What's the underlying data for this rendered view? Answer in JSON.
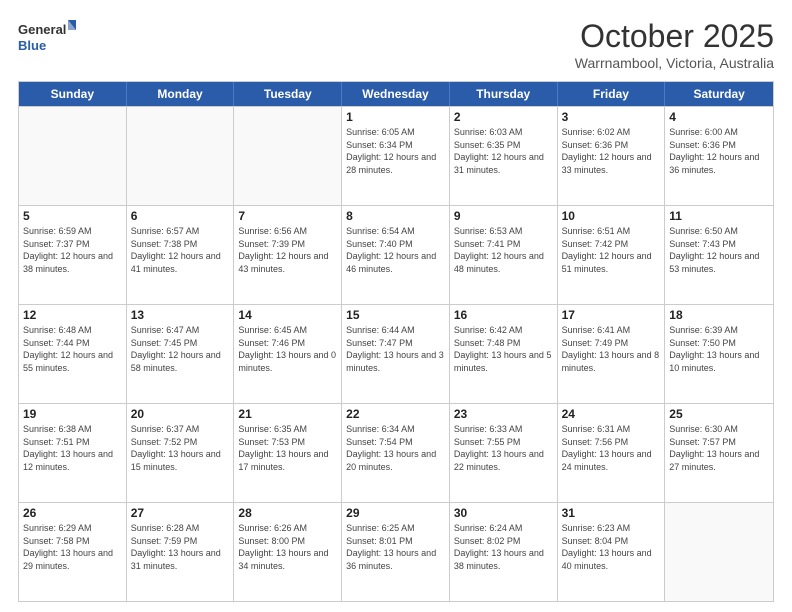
{
  "header": {
    "logo_general": "General",
    "logo_blue": "Blue",
    "month_title": "October 2025",
    "subtitle": "Warrnambool, Victoria, Australia"
  },
  "weekdays": [
    "Sunday",
    "Monday",
    "Tuesday",
    "Wednesday",
    "Thursday",
    "Friday",
    "Saturday"
  ],
  "weeks": [
    [
      {
        "day": "",
        "info": ""
      },
      {
        "day": "",
        "info": ""
      },
      {
        "day": "",
        "info": ""
      },
      {
        "day": "1",
        "info": "Sunrise: 6:05 AM\nSunset: 6:34 PM\nDaylight: 12 hours\nand 28 minutes."
      },
      {
        "day": "2",
        "info": "Sunrise: 6:03 AM\nSunset: 6:35 PM\nDaylight: 12 hours\nand 31 minutes."
      },
      {
        "day": "3",
        "info": "Sunrise: 6:02 AM\nSunset: 6:36 PM\nDaylight: 12 hours\nand 33 minutes."
      },
      {
        "day": "4",
        "info": "Sunrise: 6:00 AM\nSunset: 6:36 PM\nDaylight: 12 hours\nand 36 minutes."
      }
    ],
    [
      {
        "day": "5",
        "info": "Sunrise: 6:59 AM\nSunset: 7:37 PM\nDaylight: 12 hours\nand 38 minutes."
      },
      {
        "day": "6",
        "info": "Sunrise: 6:57 AM\nSunset: 7:38 PM\nDaylight: 12 hours\nand 41 minutes."
      },
      {
        "day": "7",
        "info": "Sunrise: 6:56 AM\nSunset: 7:39 PM\nDaylight: 12 hours\nand 43 minutes."
      },
      {
        "day": "8",
        "info": "Sunrise: 6:54 AM\nSunset: 7:40 PM\nDaylight: 12 hours\nand 46 minutes."
      },
      {
        "day": "9",
        "info": "Sunrise: 6:53 AM\nSunset: 7:41 PM\nDaylight: 12 hours\nand 48 minutes."
      },
      {
        "day": "10",
        "info": "Sunrise: 6:51 AM\nSunset: 7:42 PM\nDaylight: 12 hours\nand 51 minutes."
      },
      {
        "day": "11",
        "info": "Sunrise: 6:50 AM\nSunset: 7:43 PM\nDaylight: 12 hours\nand 53 minutes."
      }
    ],
    [
      {
        "day": "12",
        "info": "Sunrise: 6:48 AM\nSunset: 7:44 PM\nDaylight: 12 hours\nand 55 minutes."
      },
      {
        "day": "13",
        "info": "Sunrise: 6:47 AM\nSunset: 7:45 PM\nDaylight: 12 hours\nand 58 minutes."
      },
      {
        "day": "14",
        "info": "Sunrise: 6:45 AM\nSunset: 7:46 PM\nDaylight: 13 hours\nand 0 minutes."
      },
      {
        "day": "15",
        "info": "Sunrise: 6:44 AM\nSunset: 7:47 PM\nDaylight: 13 hours\nand 3 minutes."
      },
      {
        "day": "16",
        "info": "Sunrise: 6:42 AM\nSunset: 7:48 PM\nDaylight: 13 hours\nand 5 minutes."
      },
      {
        "day": "17",
        "info": "Sunrise: 6:41 AM\nSunset: 7:49 PM\nDaylight: 13 hours\nand 8 minutes."
      },
      {
        "day": "18",
        "info": "Sunrise: 6:39 AM\nSunset: 7:50 PM\nDaylight: 13 hours\nand 10 minutes."
      }
    ],
    [
      {
        "day": "19",
        "info": "Sunrise: 6:38 AM\nSunset: 7:51 PM\nDaylight: 13 hours\nand 12 minutes."
      },
      {
        "day": "20",
        "info": "Sunrise: 6:37 AM\nSunset: 7:52 PM\nDaylight: 13 hours\nand 15 minutes."
      },
      {
        "day": "21",
        "info": "Sunrise: 6:35 AM\nSunset: 7:53 PM\nDaylight: 13 hours\nand 17 minutes."
      },
      {
        "day": "22",
        "info": "Sunrise: 6:34 AM\nSunset: 7:54 PM\nDaylight: 13 hours\nand 20 minutes."
      },
      {
        "day": "23",
        "info": "Sunrise: 6:33 AM\nSunset: 7:55 PM\nDaylight: 13 hours\nand 22 minutes."
      },
      {
        "day": "24",
        "info": "Sunrise: 6:31 AM\nSunset: 7:56 PM\nDaylight: 13 hours\nand 24 minutes."
      },
      {
        "day": "25",
        "info": "Sunrise: 6:30 AM\nSunset: 7:57 PM\nDaylight: 13 hours\nand 27 minutes."
      }
    ],
    [
      {
        "day": "26",
        "info": "Sunrise: 6:29 AM\nSunset: 7:58 PM\nDaylight: 13 hours\nand 29 minutes."
      },
      {
        "day": "27",
        "info": "Sunrise: 6:28 AM\nSunset: 7:59 PM\nDaylight: 13 hours\nand 31 minutes."
      },
      {
        "day": "28",
        "info": "Sunrise: 6:26 AM\nSunset: 8:00 PM\nDaylight: 13 hours\nand 34 minutes."
      },
      {
        "day": "29",
        "info": "Sunrise: 6:25 AM\nSunset: 8:01 PM\nDaylight: 13 hours\nand 36 minutes."
      },
      {
        "day": "30",
        "info": "Sunrise: 6:24 AM\nSunset: 8:02 PM\nDaylight: 13 hours\nand 38 minutes."
      },
      {
        "day": "31",
        "info": "Sunrise: 6:23 AM\nSunset: 8:04 PM\nDaylight: 13 hours\nand 40 minutes."
      },
      {
        "day": "",
        "info": ""
      }
    ]
  ]
}
